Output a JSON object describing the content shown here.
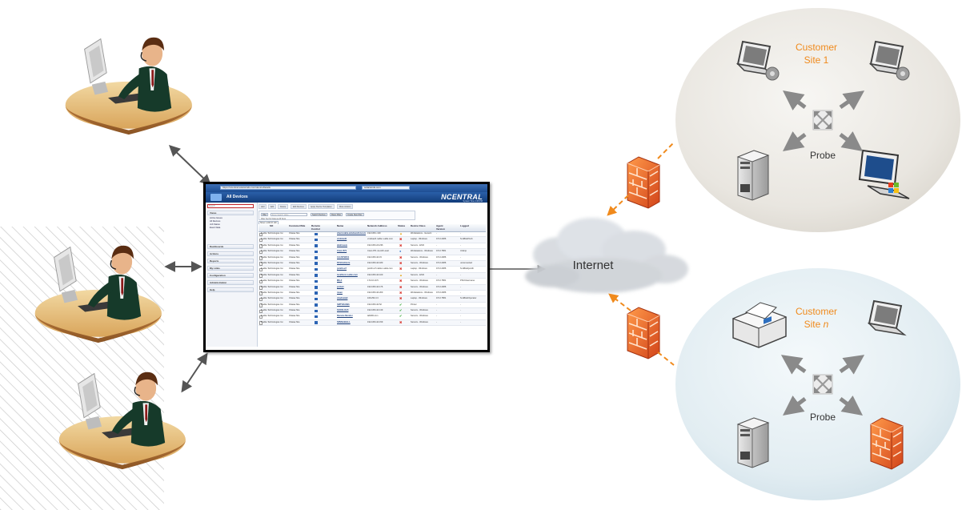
{
  "diagram": {
    "internet_label": "Internet",
    "site1": {
      "title_line1": "Customer",
      "title_line2": "Site 1",
      "probe_label": "Probe"
    },
    "siten": {
      "title_line1": "Customer",
      "title_line2_prefix": "Site ",
      "title_line2_var": "n",
      "probe_label": "Probe"
    },
    "colors": {
      "accent_orange": "#f08a1c",
      "arrow_gray": "#8a8a8a",
      "site1_bg": "#ebe8e2",
      "siten_bg": "#e1edf2"
    }
  },
  "console": {
    "browser_url": "https://ncentral.solarwinds.com/deviceDetails",
    "browser_search": "solarwinds.com",
    "page_title": "All Devices",
    "brand": "NCENTRAL",
    "brand_prefix": "N",
    "brand_sub": "System Time 1:08 PM",
    "search_placeholder": "Search",
    "sidebar": {
      "views_header": "Views",
      "views_items": [
        "Active Issues",
        "All Devices",
        "Job Status",
        "Event Data"
      ],
      "sections": [
        "Dashboards",
        "Actions",
        "Reports",
        "My Links",
        "Configuration",
        "Administration",
        "Help"
      ]
    },
    "tabs": [
      "Add",
      "Edit",
      "Delete",
      "Edit Devices",
      "Apply Device Templates",
      "More Actions"
    ],
    "filter": {
      "filter_button": "Filter",
      "filter_placeholder": "Enter Search Value",
      "search_button": "Search Devices",
      "reset_button": "Reset Filter",
      "create_button": "Create New Filter",
      "note": "Filter Set for Data as All Devs"
    },
    "select_label": "Show 1-100 Of 100",
    "columns": [
      "SO",
      "Customer/Site",
      "Remote Control",
      "Name",
      "Network Address",
      "Status",
      "Device Class",
      "Agent Version",
      "Logged"
    ],
    "rows": [
      {
        "so": "N-able Technologies Inc.",
        "site": "Ottawa Site",
        "name": "client.nable.windows8.msn.local",
        "addr": "192.168.1.100",
        "status": "warn",
        "cls": "Workstations - Generic",
        "ver": "-",
        "log": "-"
      },
      {
        "so": "N-able Technologies Inc.",
        "site": "Ottawa Site",
        "name": "vmdcauth",
        "addr": "vmdcauth.nable.n-able.com",
        "status": "down",
        "cls": "Laptop - Windows",
        "ver": "9.5.0.2386",
        "log": "N-ABLE\\Tech"
      },
      {
        "so": "N-able Technologies Inc.",
        "site": "Ottawa Site",
        "name": "abahreaux",
        "addr": "192.168.120.236",
        "status": "down",
        "cls": "Servers - ESXi",
        "ver": "-",
        "log": "-"
      },
      {
        "so": "N-able Technologies Inc.",
        "site": "Ottawa Site",
        "name": "Cisco 871",
        "addr": "Cisco 871 via AD Local",
        "status": "info",
        "cls": "Workstations - Windows",
        "ver": "9.5.0.7581",
        "log": "Unlimp"
      },
      {
        "so": "N-able Technologies Inc.",
        "site": "Ottawa Site",
        "name": "CLUSTER01",
        "addr": "192.168.110.15",
        "status": "down",
        "cls": "Servers - Windows",
        "ver": "9.5.0.2386",
        "log": "-"
      },
      {
        "so": "N-able Technologies Inc.",
        "site": "Ottawa Site",
        "name": "DCVendmore",
        "addr": "192.168.110.180",
        "status": "down",
        "cls": "Servers - Windows",
        "ver": "9.5.0.2386",
        "log": "unconnected"
      },
      {
        "so": "N-able Technologies Inc.",
        "site": "Ottawa Site",
        "name": "jsmith-w7",
        "addr": "jsmith-w7.nable.n-able.com",
        "status": "down",
        "cls": "Laptop - Windows",
        "ver": "9.5.0.2386",
        "log": "N-ABLE\\jsmith"
      },
      {
        "so": "N-able Technologies Inc.",
        "site": "Ottawa Site",
        "name": "localhost.n-able.com",
        "addr": "192.168.110.100",
        "status": "warn",
        "cls": "Servers - ESXi",
        "ver": "-",
        "log": "-"
      },
      {
        "so": "N-able Technologies Inc.",
        "site": "Ottawa Site",
        "name": "MS-F",
        "addr": "172.16.10.5",
        "status": "down",
        "cls": "Servers - Windows",
        "ver": "9.5.0.7581",
        "log": "PSC\\Username"
      },
      {
        "so": "N-able Technologies Inc.",
        "site": "Ottawa Site",
        "name": "probe1",
        "addr": "192.168.110.176",
        "status": "down",
        "cls": "Servers - Windows",
        "ver": "9.5.0.2386",
        "log": "-"
      },
      {
        "so": "N-able Technologies Inc.",
        "site": "Ottawa Site",
        "name": "raven",
        "addr": "192.168.110.200",
        "status": "down",
        "cls": "Workstations - Windows",
        "ver": "9.5.0.2386",
        "log": "-"
      },
      {
        "so": "N-able Technologies Inc.",
        "site": "Ottawa Site",
        "name": "shadowtail",
        "addr": "169.254.0.3",
        "status": "down",
        "cls": "Laptop - Windows",
        "ver": "9.5.0.7581",
        "log": "N-ABLE\\Operator"
      },
      {
        "so": "N-able Technologies Inc.",
        "site": "Ottawa Site",
        "name": "SMTVDAN01",
        "addr": "192.168.110.52",
        "status": "ok",
        "cls": "Printer",
        "ver": "-",
        "log": "-"
      },
      {
        "so": "N-able Technologies Inc.",
        "site": "Ottawa Site",
        "name": "SOCKLOA5",
        "addr": "192.168.110.139",
        "status": "ok",
        "cls": "Servers - Windows",
        "ver": "-",
        "log": "-"
      },
      {
        "so": "N-able Technologies Inc.",
        "site": "Ottawa Site",
        "name": "Remote Monitor",
        "addr": "lab000.com",
        "status": "ok",
        "cls": "Servers - Windows",
        "ver": "-",
        "log": "-"
      },
      {
        "so": "N-able Technologies Inc.",
        "site": "Ottawa Site",
        "name": "SRVNABLE-L",
        "addr": "192.168.110.159",
        "status": "down",
        "cls": "Servers - Windows",
        "ver": "-",
        "log": "-"
      }
    ]
  }
}
